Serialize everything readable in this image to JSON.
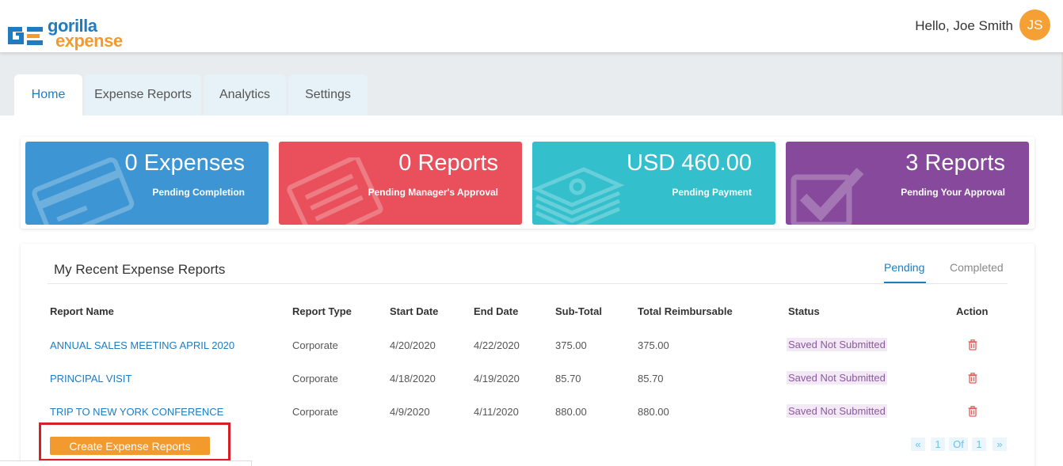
{
  "header": {
    "logo_line1": "gorilla",
    "logo_line2": "expense",
    "greeting": "Hello, Joe Smith",
    "avatar_initials": "JS"
  },
  "tabs": [
    {
      "label": "Home",
      "active": true
    },
    {
      "label": "Expense Reports",
      "active": false
    },
    {
      "label": "Analytics",
      "active": false
    },
    {
      "label": "Settings",
      "active": false
    }
  ],
  "cards": [
    {
      "value": "0 Expenses",
      "label": "Pending Completion",
      "color": "#3d96d3",
      "icon": "credit-card-icon"
    },
    {
      "value": "0 Reports",
      "label": "Pending Manager's Approval",
      "color": "#e9505b",
      "icon": "document-icon"
    },
    {
      "value": "USD 460.00",
      "label": "Pending Payment",
      "color": "#34bfcc",
      "icon": "money-stack-icon"
    },
    {
      "value": "3 Reports",
      "label": "Pending Your Approval",
      "color": "#86499b",
      "icon": "checkmark-icon"
    }
  ],
  "recent": {
    "title": "My Recent Expense Reports",
    "tab_pending": "Pending",
    "tab_completed": "Completed",
    "columns": [
      "Report Name",
      "Report Type",
      "Start Date",
      "End Date",
      "Sub-Total",
      "Total Reimbursable",
      "Status",
      "Action"
    ],
    "rows": [
      {
        "name": "ANNUAL SALES MEETING APRIL 2020",
        "type": "Corporate",
        "start": "4/20/2020",
        "end": "4/22/2020",
        "subtotal": "375.00",
        "reimbursable": "375.00",
        "status": "Saved Not Submitted"
      },
      {
        "name": "PRINCIPAL VISIT",
        "type": "Corporate",
        "start": "4/18/2020",
        "end": "4/19/2020",
        "subtotal": "85.70",
        "reimbursable": "85.70",
        "status": "Saved Not Submitted"
      },
      {
        "name": "TRIP TO NEW YORK CONFERENCE",
        "type": "Corporate",
        "start": "4/9/2020",
        "end": "4/11/2020",
        "subtotal": "880.00",
        "reimbursable": "880.00",
        "status": "Saved Not Submitted"
      }
    ],
    "create_button": "Create Expense Reports",
    "pager": {
      "first": "«",
      "current": "1",
      "of": "Of",
      "total": "1",
      "next": "»"
    }
  },
  "colors": {
    "accent": "#1f7cc1",
    "orange": "#f29a2e",
    "highlight_box": "#d91f26"
  }
}
